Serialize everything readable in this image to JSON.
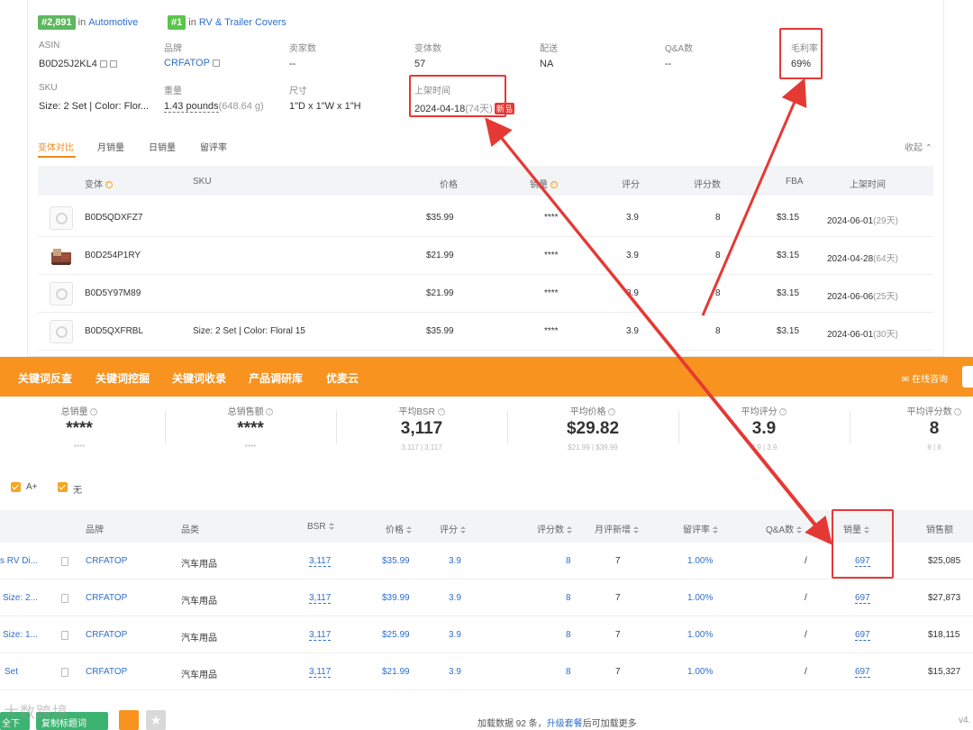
{
  "ranks": [
    {
      "rank": "#2,891",
      "in": "in",
      "category": "Automotive"
    },
    {
      "rank": "#1",
      "in": "in",
      "category": "RV & Trailer Covers"
    }
  ],
  "info": {
    "asin_label": "ASIN",
    "asin": "B0D25J2KL4",
    "brand_label": "品牌",
    "brand": "CRFATOP",
    "sellers_label": "卖家数",
    "sellers": "--",
    "variants_label": "变体数",
    "variants": "57",
    "delivery_label": "配送",
    "delivery": "NA",
    "qa_label": "Q&A数",
    "qa": "--",
    "margin_label": "毛利率",
    "margin": "69%",
    "sku_label": "SKU",
    "sku": "Size: 2 Set | Color: Flor...",
    "weight_label": "重量",
    "weight": "1.43 pounds",
    "weight_g": "(648.64 g)",
    "size_label": "尺寸",
    "size": "1\"D x 1\"W x 1\"H",
    "listed_label": "上架时间",
    "listed": "2024-04-18",
    "listed_days": "(74天)",
    "new_badge": "新品"
  },
  "tabs": [
    "变体对比",
    "月销量",
    "日销量",
    "留评率"
  ],
  "collapse": "收起",
  "variant_headers": [
    "变体",
    "SKU",
    "价格",
    "销量",
    "评分",
    "评分数",
    "FBA",
    "上架时间"
  ],
  "variants": [
    {
      "asin": "B0D5QDXFZ7",
      "sku": "",
      "price": "$35.99",
      "sales": "****",
      "rating": "3.9",
      "reviews": "8",
      "fba": "$3.15",
      "date": "2024-06-01",
      "days": "(29天)"
    },
    {
      "asin": "B0D254P1RY",
      "sku": "",
      "price": "$21.99",
      "sales": "****",
      "rating": "3.9",
      "reviews": "8",
      "fba": "$3.15",
      "date": "2024-04-28",
      "days": "(64天)"
    },
    {
      "asin": "B0D5Y97M89",
      "sku": "",
      "price": "$21.99",
      "sales": "****",
      "rating": "3.9",
      "reviews": "8",
      "fba": "$3.15",
      "date": "2024-06-06",
      "days": "(25天)"
    },
    {
      "asin": "B0D5QXFRBL",
      "sku": "Size: 2 Set | Color: Floral 15",
      "price": "$35.99",
      "sales": "****",
      "rating": "3.9",
      "reviews": "8",
      "fba": "$3.15",
      "date": "2024-06-01",
      "days": "(30天)"
    }
  ],
  "nav": [
    "关键词反查",
    "关键词挖掘",
    "关键词收录",
    "产品调研库",
    "优麦云"
  ],
  "consult": "在线咨询",
  "stats": [
    {
      "title": "总销量",
      "value": "****",
      "sub": "****"
    },
    {
      "title": "总销售额",
      "value": "****",
      "sub": "****"
    },
    {
      "title": "平均BSR",
      "value": "3,117",
      "sub": "3,117 | 3,117"
    },
    {
      "title": "平均价格",
      "value": "$29.82",
      "sub": "$21.99 | $39.99"
    },
    {
      "title": "平均评分",
      "value": "3.9",
      "sub": "3.9 | 3.9"
    },
    {
      "title": "平均评分数",
      "value": "8",
      "sub": "8 | 8"
    }
  ],
  "checkboxes": [
    "A+",
    "无"
  ],
  "product_headers": [
    "品牌",
    "品类",
    "BSR",
    "价格",
    "评分",
    "评分数",
    "月评新增",
    "留评率",
    "Q&A数",
    "销量",
    "销售额"
  ],
  "products": [
    {
      "title": "s RV Di...",
      "brand": "CRFATOP",
      "category": "汽车用品",
      "bsr": "3,117",
      "price": "$35.99",
      "rating": "3.9",
      "reviews": "8",
      "monthly": "7",
      "rate": "1.00%",
      "qa": "/",
      "sales": "697",
      "revenue": "$25,085"
    },
    {
      "title": "Size: 2...",
      "brand": "CRFATOP",
      "category": "汽车用品",
      "bsr": "3,117",
      "price": "$39.99",
      "rating": "3.9",
      "reviews": "8",
      "monthly": "7",
      "rate": "1.00%",
      "qa": "/",
      "sales": "697",
      "revenue": "$27,873"
    },
    {
      "title": "Size: 1...",
      "brand": "CRFATOP",
      "category": "汽车用品",
      "bsr": "3,117",
      "price": "$25.99",
      "rating": "3.9",
      "reviews": "8",
      "monthly": "7",
      "rate": "1.00%",
      "qa": "/",
      "sales": "697",
      "revenue": "$18,115"
    },
    {
      "title": "Set",
      "brand": "CRFATOP",
      "category": "汽车用品",
      "bsr": "3,117",
      "price": "$21.99",
      "rating": "3.9",
      "reviews": "8",
      "monthly": "7",
      "rate": "1.00%",
      "qa": "/",
      "sales": "697",
      "revenue": "$15,327"
    }
  ],
  "bottom": {
    "download": "全下载",
    "export_kw": "复制标题词",
    "load_more_prefix": "加载数据 92 条，",
    "load_more_link": "升级套餐",
    "load_more_suffix": "后可加载更多",
    "version": "v4.",
    "watermark": "大数跨境"
  },
  "colors": {
    "accent": "#f7931e",
    "annotation": "#e53935",
    "link": "#2f6fca"
  }
}
